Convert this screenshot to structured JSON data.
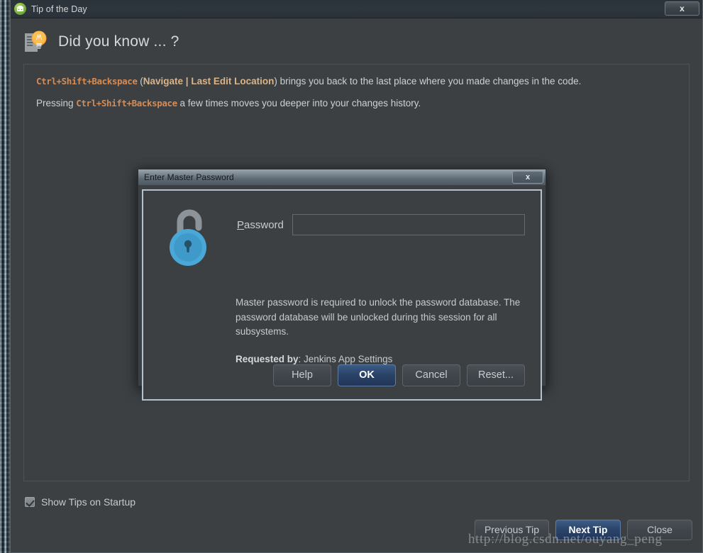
{
  "window": {
    "title": "Tip of the Day",
    "app_icon": "android-studio-icon",
    "close_label": "x"
  },
  "heading": {
    "text": "Did you know ... ?",
    "icon": "tip-lightbulb-icon"
  },
  "tip": {
    "paragraph1": {
      "shortcut": "Ctrl+Shift+Backspace",
      "open_paren": " (",
      "menu_path": "Navigate | Last Edit Location",
      "rest": ") brings you back to the last place where you made changes in the code."
    },
    "paragraph2": {
      "lead": "Pressing ",
      "shortcut": "Ctrl+Shift+Backspace",
      "rest": " a few times moves you deeper into your changes history."
    }
  },
  "startup": {
    "checkbox_label": "Show Tips on Startup",
    "checked": true
  },
  "footer": {
    "previous_label": "Previous Tip",
    "next_label": "Next Tip",
    "close_label": "Close"
  },
  "dialog": {
    "title": "Enter Master Password",
    "close_label": "x",
    "icon": "open-padlock-icon",
    "password_label_mnemonic": "P",
    "password_label_rest": "assword",
    "password_value": "",
    "password_placeholder": "",
    "message": "Master password is required to unlock the password database. The password database will be unlocked during this session for all subsystems.",
    "requested_by_label": "Requested by",
    "requested_by_sep": ": ",
    "requested_by_value": "Jenkins App Settings",
    "buttons": {
      "help": "Help",
      "ok": "OK",
      "cancel": "Cancel",
      "reset": "Reset..."
    }
  },
  "watermark": {
    "text": "http://blog.csdn.net/ouyang_peng"
  },
  "colors": {
    "window_bg": "#3c4043",
    "accent_shortcut": "#d58b53",
    "accent_menu": "#d9b48a",
    "primary_button": "#2b4469",
    "lock_blue": "#4aa8d8"
  }
}
